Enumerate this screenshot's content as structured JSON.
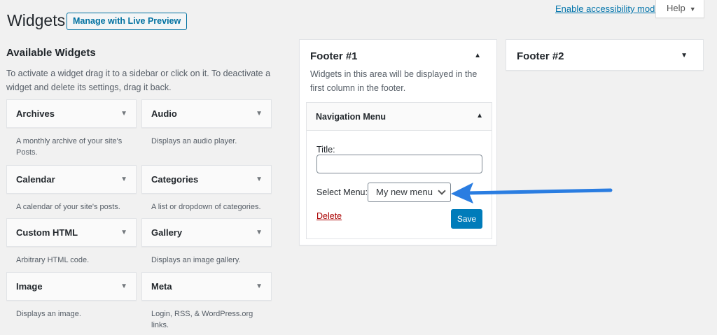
{
  "header": {
    "title": "Widgets",
    "live_preview_label": "Manage with Live Preview",
    "accessibility_link": "Enable accessibility mode",
    "help_label": "Help"
  },
  "available": {
    "title": "Available Widgets",
    "description": "To activate a widget drag it to a sidebar or click on it. To deactivate a widget and delete its settings, drag it back.",
    "widgets": [
      {
        "name": "Archives",
        "description": "A monthly archive of your site's Posts."
      },
      {
        "name": "Audio",
        "description": "Displays an audio player."
      },
      {
        "name": "Calendar",
        "description": "A calendar of your site's posts."
      },
      {
        "name": "Categories",
        "description": "A list or dropdown of categories."
      },
      {
        "name": "Custom HTML",
        "description": "Arbitrary HTML code."
      },
      {
        "name": "Gallery",
        "description": "Displays an image gallery."
      },
      {
        "name": "Image",
        "description": "Displays an image."
      },
      {
        "name": "Meta",
        "description": "Login, RSS, & WordPress.org links."
      }
    ]
  },
  "footer1": {
    "title": "Footer #1",
    "description": "Widgets in this area will be displayed in the first column in the footer.",
    "nav_widget": {
      "title": "Navigation Menu",
      "title_label": "Title:",
      "title_value": "",
      "select_label": "Select Menu:",
      "select_value": "My new menu",
      "delete_label": "Delete",
      "save_label": "Save"
    }
  },
  "footer2": {
    "title": "Footer #2"
  },
  "annotation": {
    "arrow_color": "#2a7de1"
  }
}
